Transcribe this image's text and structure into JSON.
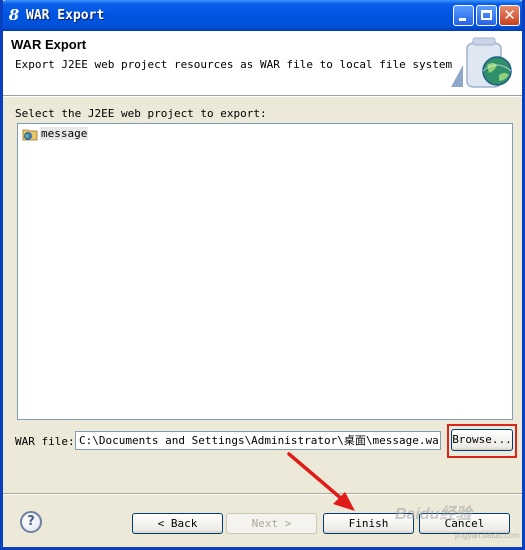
{
  "window": {
    "title": "WAR Export",
    "title_icon": "eclipse-icon"
  },
  "header": {
    "title": "WAR Export",
    "description": "Export J2EE web project resources as WAR file to local file system"
  },
  "main": {
    "select_label": "Select the J2EE web project to export:",
    "projects": [
      {
        "label": "message",
        "icon": "web-project-icon",
        "selected": true
      }
    ],
    "war_file_label": "WAR file:",
    "war_file_value": "C:\\Documents and Settings\\Administrator\\桌面\\message.war",
    "browse_label": "Browse..."
  },
  "footer": {
    "back_label": "< Back",
    "next_label": "Next >",
    "finish_label": "Finish",
    "cancel_label": "Cancel"
  },
  "watermark": {
    "brand": "Baidu经验",
    "url": "jingyan.baidu.com"
  },
  "colors": {
    "titlebar": "#0054e3",
    "annotation": "#d9261c",
    "dialog_bg": "#ece9d8"
  }
}
